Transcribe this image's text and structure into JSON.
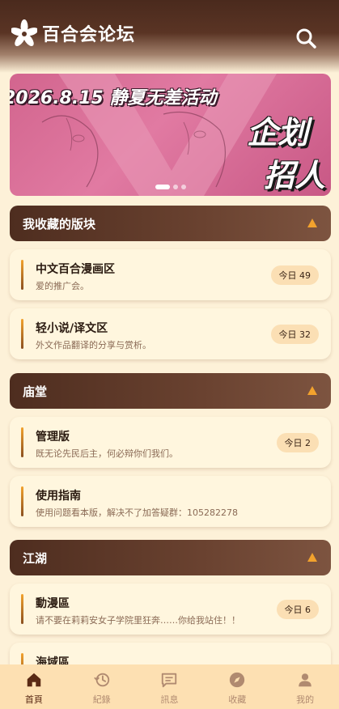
{
  "header": {
    "title": "百合会论坛",
    "logo_icon": "lily-flower-icon",
    "search_icon": "search-icon"
  },
  "banner": {
    "headline": "2026.8.15 静夏无差活动",
    "big_line1": "企划",
    "big_line2": "招人",
    "active_slide": 1,
    "slide_count": 3
  },
  "sections": [
    {
      "title": "我收藏的版块",
      "boards": [
        {
          "title": "中文百合漫画区",
          "desc": "爱的推广会。",
          "badge": "今日 49"
        },
        {
          "title": "轻小说/译文区",
          "desc": "外文作品翻译的分享与赏析。",
          "badge": "今日 32"
        }
      ]
    },
    {
      "title": "庙堂",
      "boards": [
        {
          "title": "管理版",
          "desc": "既无论先民后主，何必辩你们我们。",
          "badge": "今日 2"
        },
        {
          "title": "使用指南",
          "desc": "使用问题看本版，解决不了加答疑群：105282278",
          "badge": ""
        }
      ]
    },
    {
      "title": "江湖",
      "boards": [
        {
          "title": "動漫區",
          "desc": "请不要在莉莉安女子学院里狂奔……你给我站住！！",
          "badge": "今日 6"
        },
        {
          "title": "海域區",
          "desc": "",
          "badge": ""
        }
      ]
    }
  ],
  "nav": [
    {
      "label": "首頁",
      "icon": "home-icon",
      "active": true
    },
    {
      "label": "紀錄",
      "icon": "history-icon",
      "active": false
    },
    {
      "label": "訊息",
      "icon": "message-icon",
      "active": false
    },
    {
      "label": "收藏",
      "icon": "compass-icon",
      "active": false
    },
    {
      "label": "我的",
      "icon": "user-icon",
      "active": false
    }
  ],
  "colors": {
    "background": "#fdf1d8",
    "section_header": "#5a3424",
    "accent": "#f2a22d",
    "card": "#fff6de",
    "badge": "#fbdfb4",
    "nav_bar": "#fde0b2",
    "banner": "#d2658e"
  }
}
